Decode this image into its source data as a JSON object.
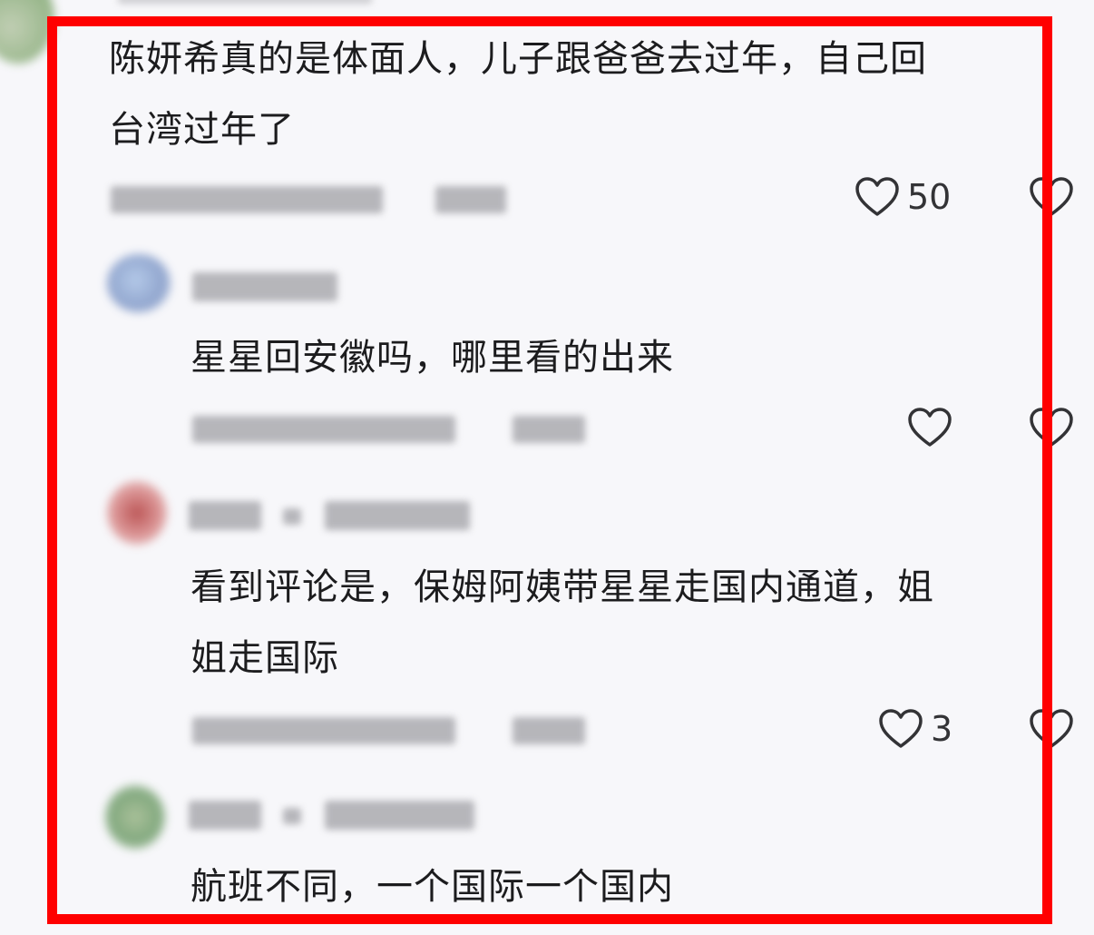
{
  "comments": [
    {
      "text": "陈妍希真的是体面人，儿子跟爸爸去过年，自己回\n台湾过年了",
      "likes": "50"
    },
    {
      "text": "星星回安徽吗，哪里看的出来",
      "likes": ""
    },
    {
      "text": "看到评论是，保姆阿姨带星星走国内通道，姐\n姐走国际",
      "likes": "3"
    },
    {
      "text": "航班不同，一个国际一个国内",
      "likes": ""
    }
  ],
  "icons": {
    "like": "heart-outline-icon"
  },
  "colors": {
    "highlight_border": "#ff0000",
    "background": "#f7f7fa",
    "text": "#1c1c1e"
  }
}
